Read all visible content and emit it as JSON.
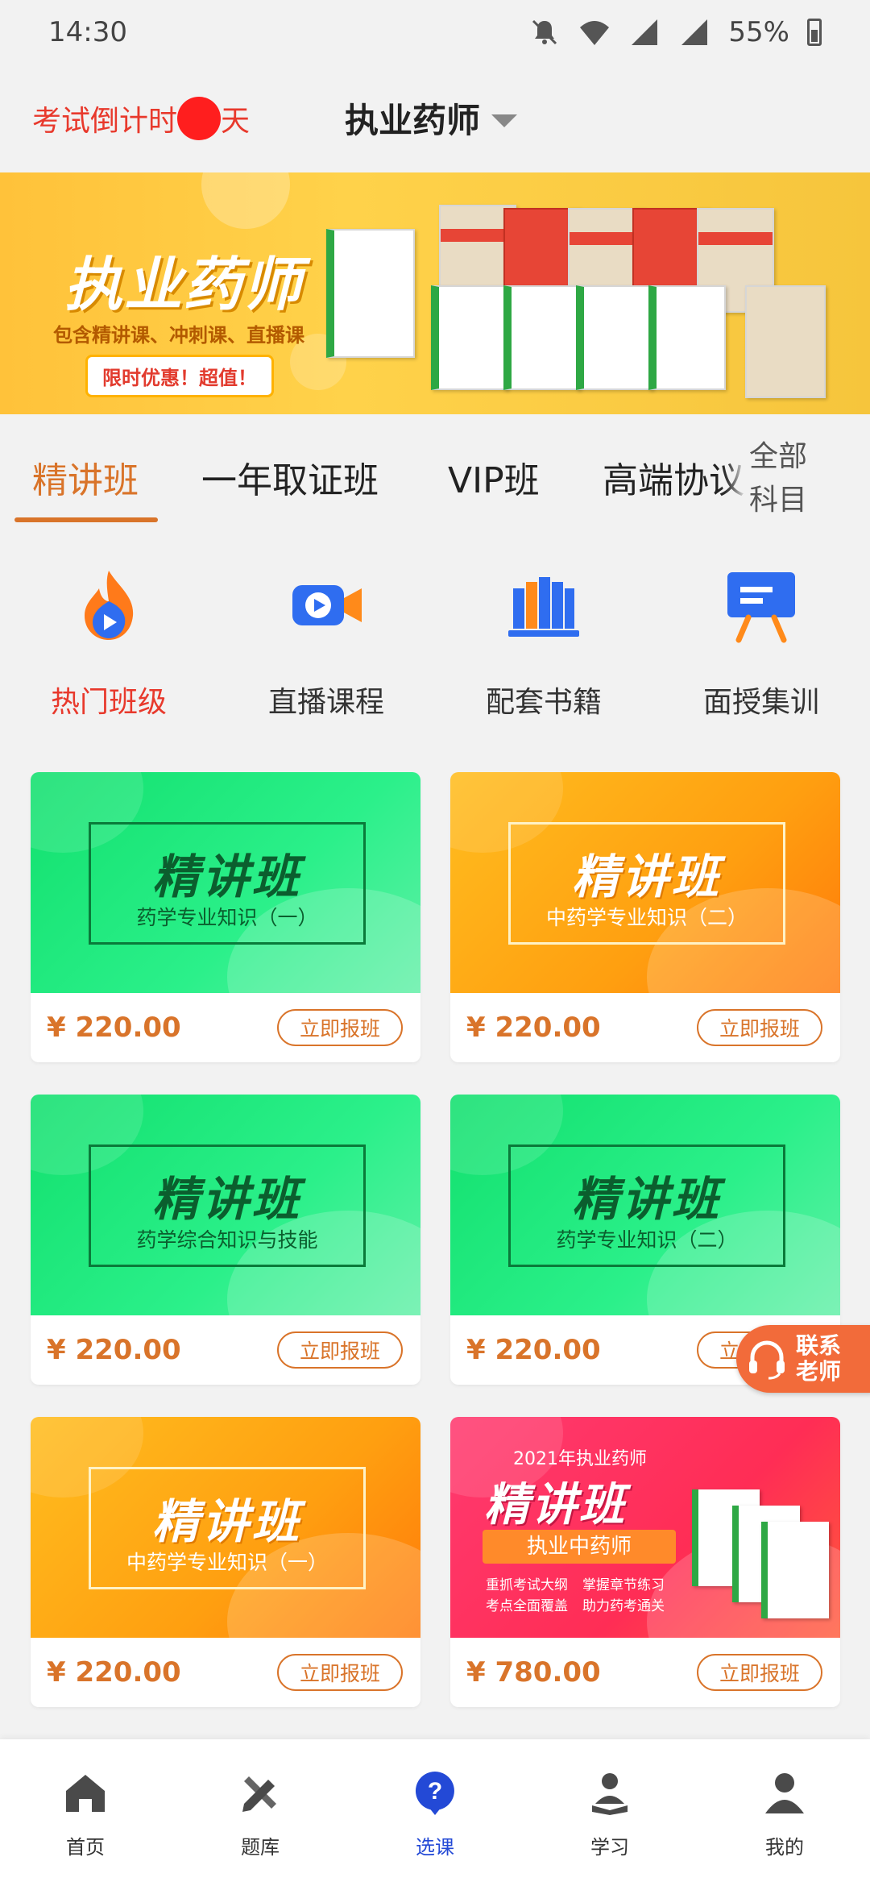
{
  "status_bar": {
    "time": "14:30",
    "battery": "55%"
  },
  "header": {
    "countdown_prefix": "考试倒计时",
    "countdown_suffix": "天",
    "title": "执业药师"
  },
  "banner": {
    "title": "执业药师",
    "subtitle": "包含精讲课、冲刺课、直播课",
    "promo": "限时优惠！超值！"
  },
  "tabs": {
    "items": [
      {
        "label": "精讲班",
        "active": true
      },
      {
        "label": "一年取证班",
        "active": false
      },
      {
        "label": "VIP班",
        "active": false
      },
      {
        "label": "高端协议",
        "active": false
      }
    ],
    "all_subjects": [
      "全部",
      "科目"
    ]
  },
  "categories": [
    {
      "label": "热门班级",
      "icon": "hot-flame-icon"
    },
    {
      "label": "直播课程",
      "icon": "live-camera-icon"
    },
    {
      "label": "配套书籍",
      "icon": "books-icon"
    },
    {
      "label": "面授集训",
      "icon": "teaching-board-icon"
    }
  ],
  "courses": [
    {
      "title": "精讲班",
      "subject": "药学专业知识（一）",
      "price": "¥ 220.00",
      "button": "立即报班",
      "theme": "green"
    },
    {
      "title": "精讲班",
      "subject": "中药学专业知识（二）",
      "price": "¥ 220.00",
      "button": "立即报班",
      "theme": "orange"
    },
    {
      "title": "精讲班",
      "subject": "药学综合知识与技能",
      "price": "¥ 220.00",
      "button": "立即报班",
      "theme": "green"
    },
    {
      "title": "精讲班",
      "subject": "药学专业知识（二）",
      "price": "¥ 220.00",
      "button": "立即报班",
      "theme": "green"
    },
    {
      "title": "精讲班",
      "subject": "中药学专业知识（一）",
      "price": "¥ 220.00",
      "button": "立即报班",
      "theme": "orange"
    },
    {
      "title": "精讲班",
      "top_line": "2021年执业药师",
      "subject": "执业中药师",
      "features": [
        "重抓考试大纲",
        "掌握章节练习",
        "考点全面覆盖",
        "助力药考通关"
      ],
      "price": "¥ 780.00",
      "button": "立即报班",
      "theme": "pink"
    }
  ],
  "contact": {
    "line1": "联系",
    "line2": "老师"
  },
  "bottom_nav": [
    {
      "label": "首页",
      "icon": "home-icon",
      "active": false
    },
    {
      "label": "题库",
      "icon": "question-bank-icon",
      "active": false
    },
    {
      "label": "选课",
      "icon": "course-select-icon",
      "active": true
    },
    {
      "label": "学习",
      "icon": "study-icon",
      "active": false
    },
    {
      "label": "我的",
      "icon": "profile-icon",
      "active": false
    }
  ],
  "colors": {
    "accent": "#d9742a",
    "countdown_red": "#e8392c",
    "nav_active": "#2349d6"
  }
}
